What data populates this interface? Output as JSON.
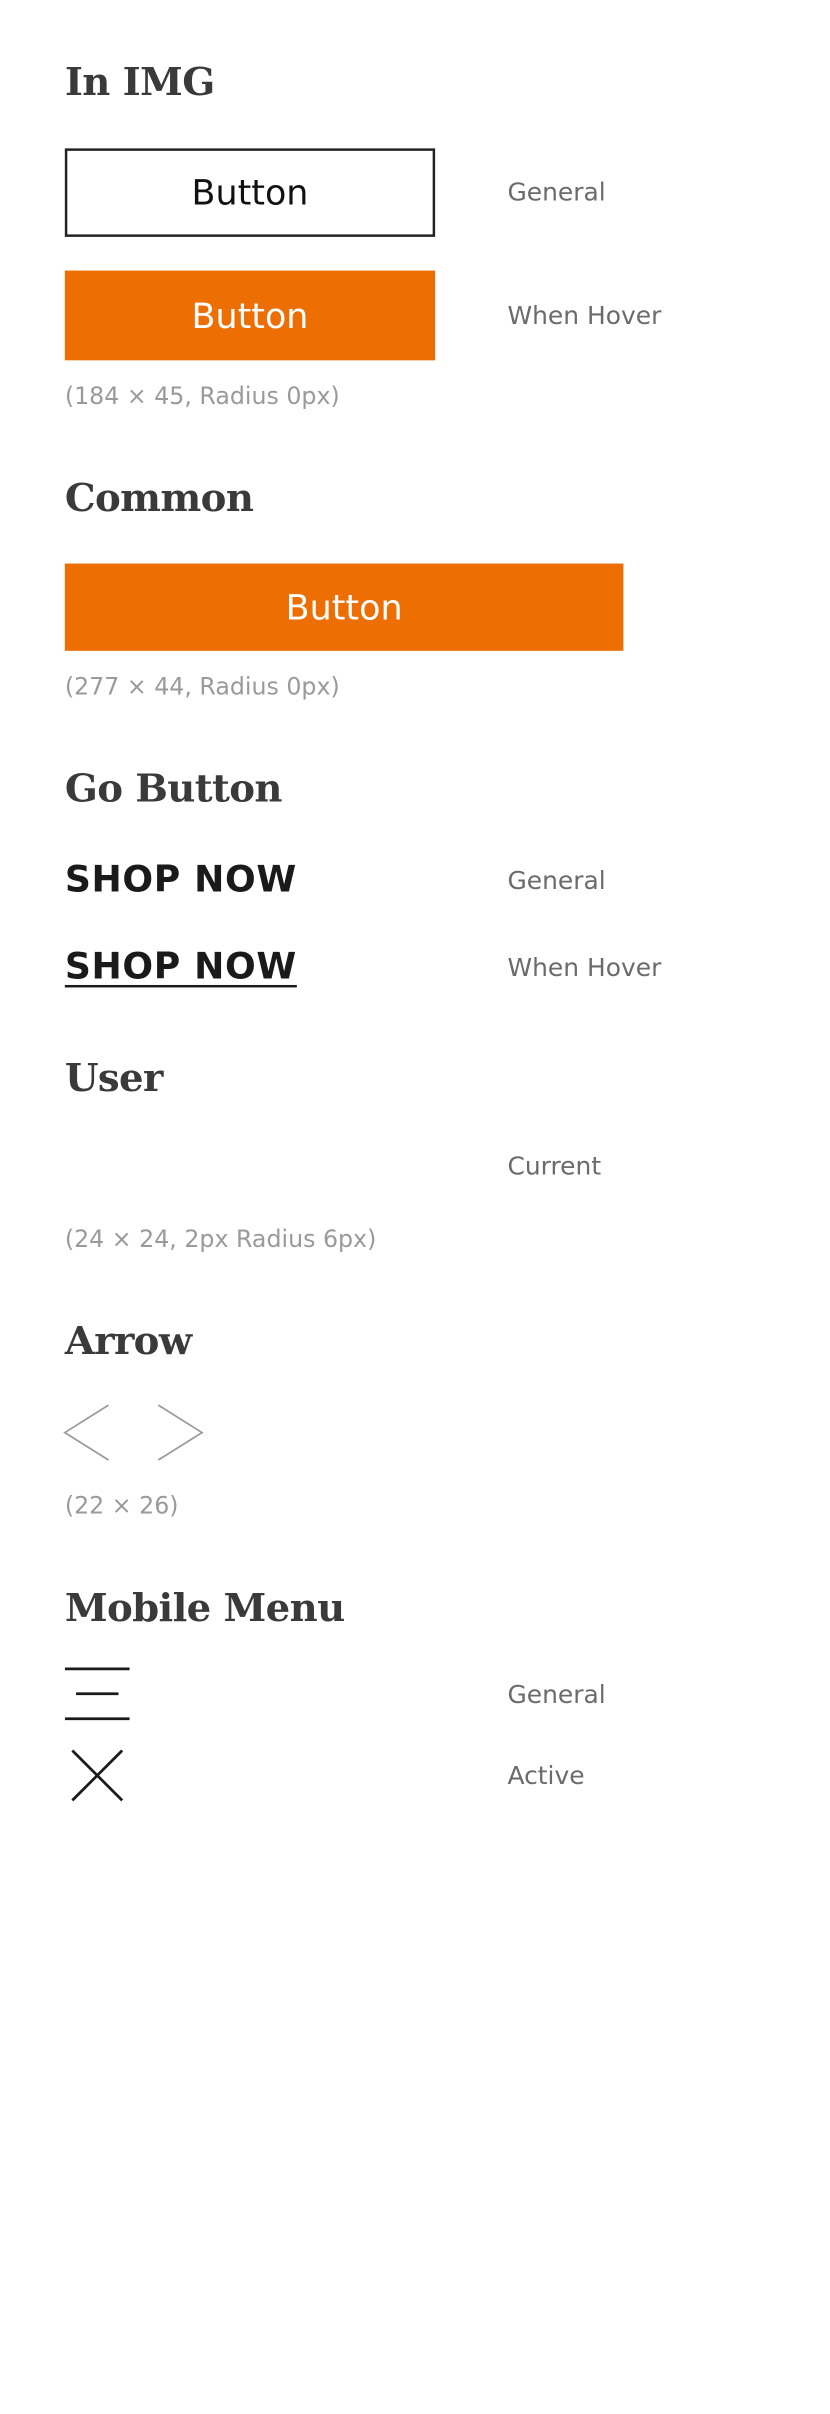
{
  "colors": {
    "accent": "#ED6E02",
    "heading": "#3a3a3a",
    "label": "#6b6b6b",
    "note": "#9a9a9a"
  },
  "sections": {
    "in_img": {
      "title": "In IMG",
      "general_button_label": "Button",
      "general_label": "General",
      "hover_button_label": "Button",
      "hover_label": "When Hover",
      "note": "(184 × 45, Radius 0px)"
    },
    "common": {
      "title": "Common",
      "button_label": "Button",
      "note": "(277 × 44, Radius 0px)"
    },
    "go_button": {
      "title": "Go Button",
      "general_text": "SHOP NOW",
      "general_label": "General",
      "hover_text": "SHOP NOW",
      "hover_label": "When Hover"
    },
    "user": {
      "title": "User",
      "current_label": "Current",
      "note": "(24 × 24, 2px Radius 6px)"
    },
    "arrow": {
      "title": "Arrow",
      "left_icon": "chevron-left-icon",
      "right_icon": "chevron-right-icon",
      "note": "(22 × 26)"
    },
    "mobile_menu": {
      "title": "Mobile Menu",
      "general_icon": "hamburger-menu-icon",
      "general_label": "General",
      "active_icon": "close-icon",
      "active_label": "Active"
    }
  }
}
